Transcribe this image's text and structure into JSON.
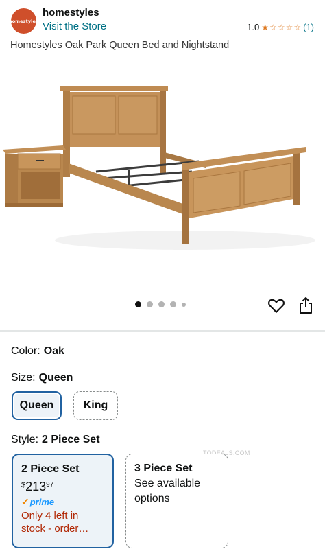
{
  "header": {
    "logo_text": "homestyles",
    "brand": "homestyles",
    "visit_store": "Visit the Store",
    "rating_value": "1.0",
    "rating_count": "(1)",
    "stars_filled": 1,
    "stars_total": 5
  },
  "product": {
    "title": "Homestyles Oak Park Queen Bed and Nightstand"
  },
  "carousel": {
    "total_images": 5,
    "active_index": 0
  },
  "color": {
    "label": "Color:",
    "value": "Oak"
  },
  "size": {
    "label": "Size:",
    "value": "Queen",
    "options": [
      "Queen",
      "King"
    ],
    "selected": "Queen"
  },
  "style": {
    "label": "Style:",
    "value": "2 Piece Set",
    "options": [
      {
        "title": "2 Piece Set",
        "price_symbol": "$",
        "price_whole": "213",
        "price_fraction": "97",
        "prime_label": "prime",
        "stock_text": "Only 4 left in stock - order…"
      },
      {
        "title": "3 Piece Set",
        "subtitle": "See available options"
      }
    ]
  },
  "watermark": "TODEALS.COM",
  "colors": {
    "link": "#007185",
    "selected_border": "#2162a1",
    "star": "#de7921",
    "stock": "#b12704",
    "prime": "#1a98ff",
    "logo": "#cf4f2b"
  },
  "icons": {
    "wishlist": "heart-icon",
    "share": "share-icon",
    "prime_check": "check-icon"
  }
}
